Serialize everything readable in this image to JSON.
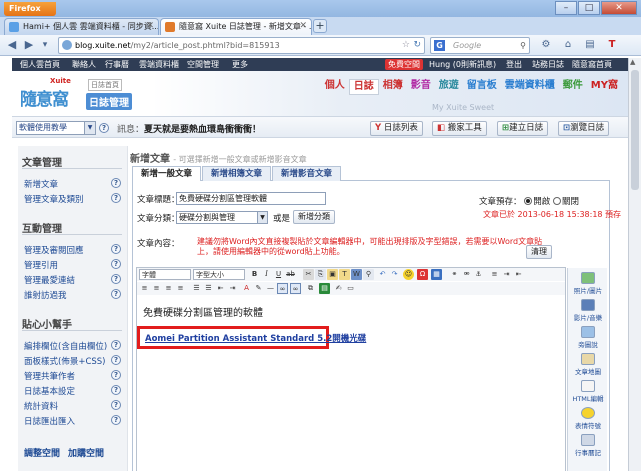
{
  "browser": {
    "app_button": "Firefox",
    "tabs": [
      {
        "label": "Hami+ 個人雲 雲端資料櫃 - 同步資..."
      },
      {
        "label": "隨意窩 Xuite 日誌管理 - 新增文章 - ..."
      }
    ],
    "new_tab": "+",
    "url_host": "blog.xuite.net",
    "url_path": "/my2/article_post.phtml?bid=815913",
    "search_placeholder": "Google",
    "search_engine": "G",
    "user_initial": "T"
  },
  "sitebar": {
    "left_items": [
      "個人雲首頁",
      "聯絡人",
      "行事曆",
      "雲端資料櫃",
      "空間管理",
      "更多"
    ],
    "badge": "免費空間",
    "right_items": [
      "Hung (0則新訊息)",
      "登出",
      "站務日誌",
      "隨意窩首頁"
    ]
  },
  "blog_header": {
    "brand_small": "Xuite",
    "brand": "隨意窩",
    "home_link": "日誌首頁",
    "manager": "日誌管理",
    "tagline": "My Xuite Sweet",
    "nav": [
      "個人",
      "日誌",
      "相簿",
      "影音",
      "旅遊",
      "留言板",
      "雲端資料櫃",
      "郵件",
      "MY窩"
    ],
    "active_nav": "日誌"
  },
  "actionbar": {
    "mode_select": "軟體使用教學",
    "msg_label": "訊息：",
    "msg_text": "夏天就是要熱血環島衝衝衝！",
    "buttons": [
      "日誌列表",
      "搬家工具",
      "建立日誌",
      "瀏覽日誌"
    ]
  },
  "sidebar": {
    "sections": [
      {
        "title": "文章管理",
        "items": [
          "新增文章",
          "管理文章及類別"
        ]
      },
      {
        "title": "互動管理",
        "items": [
          "管理及審閱回應",
          "管理引用",
          "管理最愛連結",
          "誰射訪過我"
        ]
      },
      {
        "title": "貼心小幫手",
        "items": [
          "編排欄位(含自由欄位)",
          "面板樣式(佈景+CSS)",
          "管理共筆作者",
          "日誌基本設定",
          "統計資料",
          "日誌匯出匯入"
        ]
      }
    ],
    "footer": [
      "調整空間",
      "加購空間"
    ]
  },
  "main": {
    "header_title": "新增文章",
    "header_sub": "- 可選擇新增一般文章或新增影音文章",
    "tabs": [
      "新增一般文章",
      "新增相簿文章",
      "新增影音文章"
    ],
    "title_label": "文章標題：",
    "title_value": "免費硬碟分割區管理軟體",
    "category_label": "文章分類：",
    "category_value": "硬碟分割與管理",
    "or_text": "或是",
    "new_category_btn": "新增分類",
    "preview_label": "文章預存：",
    "preview_on": "開啟",
    "preview_off": "關閉",
    "autosave": "文章已於 2013-06-18 15:38:18 預存",
    "content_label": "文章內容：",
    "warning": "建議勿將Word內文直接複製貼於文章編輯器中，可能出現排版及字型錯誤，若需要以Word文章貼上，請使用編輯器中的從word貼上功能。",
    "clear_btn": "清理",
    "toolbar_font": "字體",
    "toolbar_size": "字型大小",
    "body_heading": "免費硬碟分割區管理的軟體",
    "body_link": "Aomei Partition Assistant Standard 5.2開機光碟"
  },
  "right_tools": [
    "照片/圖片",
    "影片/音樂",
    "旁圖說",
    "文章地圖",
    "HTML編輯",
    "表情符號",
    "行事曆記"
  ]
}
